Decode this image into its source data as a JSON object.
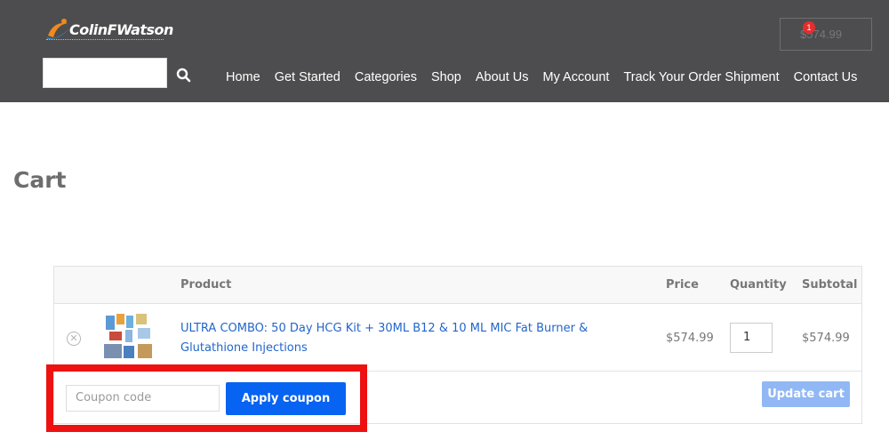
{
  "header": {
    "logo_text": "ColinFWatson",
    "logo_colors": {
      "swoosh": "#f08a1c",
      "swoosh_blue": "#2a8fd6"
    },
    "search": {
      "placeholder": "",
      "icon": "search-icon"
    },
    "cart": {
      "count": "1",
      "total": "$574.99"
    },
    "nav": [
      {
        "label": "Home"
      },
      {
        "label": "Get Started"
      },
      {
        "label": "Categories"
      },
      {
        "label": "Shop"
      },
      {
        "label": "About Us"
      },
      {
        "label": "My Account"
      },
      {
        "label": "Track Your Order Shipment"
      },
      {
        "label": "Contact Us"
      }
    ]
  },
  "page": {
    "title": "Cart"
  },
  "cart_table": {
    "columns": {
      "product": "Product",
      "price": "Price",
      "quantity": "Quantity",
      "subtotal": "Subtotal"
    },
    "rows": [
      {
        "product": "ULTRA COMBO: 50 Day HCG Kit + 30ML B12 & 10 ML MIC Fat Burner & Glutathione Injections",
        "price": "$574.99",
        "quantity": "1",
        "subtotal": "$574.99",
        "remove_icon": "close-circle-icon"
      }
    ]
  },
  "coupon": {
    "placeholder": "Coupon code",
    "apply_label": "Apply coupon"
  },
  "update_label": "Update cart",
  "colors": {
    "header_bg": "#4d4d4f",
    "primary": "#0763f2",
    "highlight": "#ee1111",
    "link": "#2266cc"
  }
}
